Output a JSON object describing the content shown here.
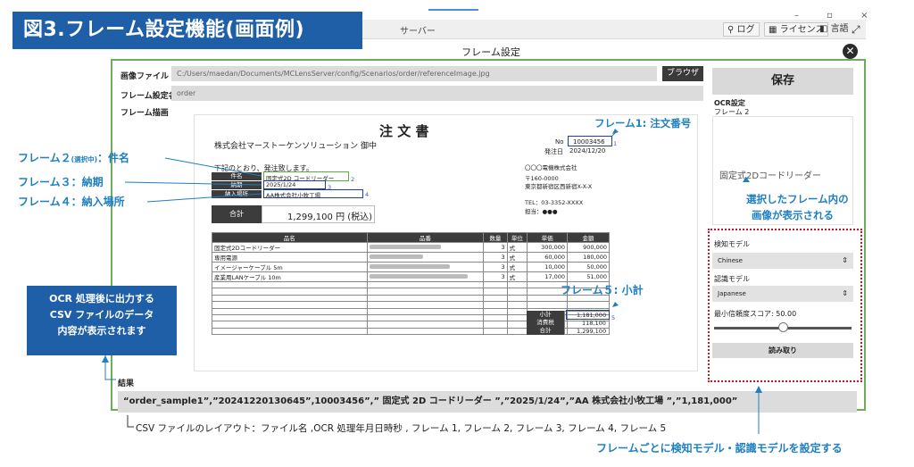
{
  "banner_title": "図3.フレーム設定機能(画面例)",
  "window": {
    "server_label": "サーバー",
    "controls": "– ▫ ×",
    "log_btn": "ログ",
    "license_btn": "ライセンス",
    "lang_btn": "言語",
    "expand": "⤢"
  },
  "dialog": {
    "title": "フレーム設定",
    "close": "✕",
    "image_file_label": "画像ファイル",
    "image_file_value": "C:/Users/maedan/Documents/MCLensServer/config/Scenarios/order/referenceImage.jpg",
    "browse_label": "ブラウザ",
    "frame_name_label": "フレーム設定名",
    "frame_name_value": "order",
    "frame_draw_label": "フレーム描画"
  },
  "invoice": {
    "title": "注 文 書",
    "company_to": "株式会社マーストーケンソリューション 御中",
    "no_label": "No",
    "no_value": "10003456",
    "date_label": "発注日",
    "date_value": "2024/12/20",
    "intro": "下記のとおり、発注致します。",
    "supplier_name": "〇〇〇電機株式会社",
    "supplier_zip": "〒160-0000",
    "supplier_addr": "東京都新宿区西新宿X-X-X",
    "supplier_tel": "TEL：03-3352-XXXX",
    "supplier_person": "担当：●●●",
    "subject_label": "件名",
    "subject_value": "固定式2D コードリーダー",
    "due_label": "納期",
    "due_value": "2025/1/24",
    "place_label": "納入場所",
    "place_value": "AA株式会社小牧工場",
    "total_label": "合計",
    "total_value": "1,299,100 円 (税込)",
    "table_headers": [
      "品名",
      "品番",
      "数量",
      "単位",
      "単価",
      "金額"
    ],
    "rows": [
      {
        "name": "固定式2Dコードリーダー",
        "qty": "3",
        "unit": "式",
        "price": "300,000",
        "amount": "900,000"
      },
      {
        "name": "専用電源",
        "qty": "3",
        "unit": "式",
        "price": "60,000",
        "amount": "180,000"
      },
      {
        "name": "イメージャーケーブル 5m",
        "qty": "3",
        "unit": "式",
        "price": "10,000",
        "amount": "50,000"
      },
      {
        "name": "産業用LANケーブル 10m",
        "qty": "3",
        "unit": "式",
        "price": "17,000",
        "amount": "51,000"
      }
    ],
    "subtotal_label": "小計",
    "subtotal_value": "1,181,000",
    "tax_label": "消費税",
    "tax_value": "118,100",
    "grand_label": "合計",
    "grand_value": "1,299,100",
    "frame_nums": [
      "1",
      "2",
      "3",
      "4",
      "5"
    ]
  },
  "right_panel": {
    "save_label": "保存",
    "ocr_setting": "OCR設定",
    "frame_label": "フレーム  2",
    "preview_text": "固定式2Dコードリーダー",
    "detect_model_label": "検知モデル",
    "detect_model_value": "Chinese",
    "recog_model_label": "認識モデル",
    "recog_model_value": "Japanese",
    "min_score_label": "最小信頼度スコア:",
    "min_score_value": "50.00",
    "read_label": "読み取り"
  },
  "results": {
    "label": "結果",
    "value": "“order_sample1”,”20241220130645”,10003456”,” 固定式 2D コードリーダー ”,”2025/1/24”,”AA 株式会社小牧工場 ”,”1,181,000”"
  },
  "annotations": {
    "frame1": "フレーム1: 注文番号",
    "frame2_pre": "フレーム２",
    "frame2_sel": "(選択中)",
    "frame2_post": "：件名",
    "frame3": "フレーム３：納期",
    "frame4": "フレーム４：納入場所",
    "frame5": "フレーム５: 小計",
    "preview_note_1": "選択したフレーム内の",
    "preview_note_2": "画像が表示される",
    "csv_note_1": "OCR 処理後に出力する",
    "csv_note_2": "CSV ファイルのデータ",
    "csv_note_3": "内容が表示されます",
    "csv_layout": "CSV ファイルのレイアウト：ファイル名 ,OCR 処理年月日時秒 , フレーム 1, フレーム 2, フレーム 3, フレーム 4, フレーム 5",
    "model_note": "フレームごとに検知モデル・認識モデルを設定する"
  },
  "colors": {
    "banner": "#1f5fa8",
    "annotation": "#1e7fc1",
    "frame_box": "#1f3f9a",
    "selected_box": "#5aac45",
    "red_dotted": "#c9142a",
    "window_border": "#6eab5a"
  }
}
